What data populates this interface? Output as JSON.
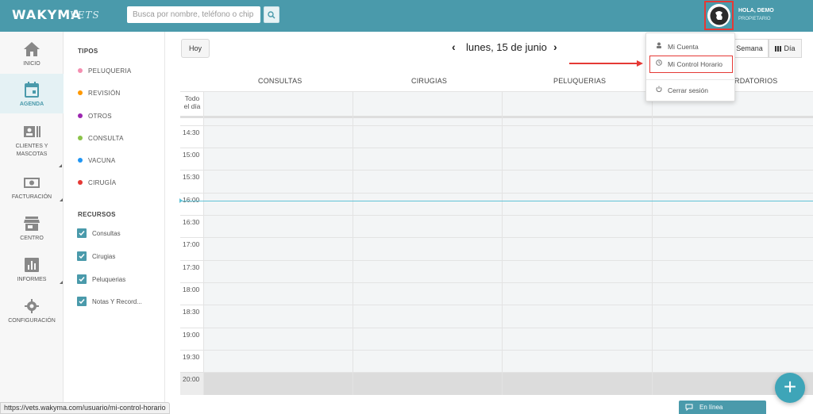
{
  "header": {
    "logo": "WAKYMA",
    "logo_sub": "VETS",
    "search_placeholder": "Busca por nombre, teléfono o chip",
    "greeting": "HOLA, DEMO",
    "role": "PROPIETARIO",
    "brand_color": "#4a9aab"
  },
  "nav": {
    "items": [
      {
        "label": "INICIO",
        "icon": "home-icon"
      },
      {
        "label": "AGENDA",
        "icon": "calendar-icon",
        "active": true
      },
      {
        "label": "CLIENTES Y",
        "label2": "MASCOTAS",
        "icon": "contacts-icon"
      },
      {
        "label": "FACTURACIÓN",
        "icon": "money-icon"
      },
      {
        "label": "CENTRO",
        "icon": "store-icon"
      },
      {
        "label": "INFORMES",
        "icon": "chart-icon"
      },
      {
        "label": "CONFIGURACIÓN",
        "icon": "gear-icon"
      }
    ]
  },
  "filters": {
    "types_title": "TIPOS",
    "types": [
      {
        "label": "PELUQUERIA",
        "color": "#f48fb1"
      },
      {
        "label": "REVISIÓN",
        "color": "#ff9800"
      },
      {
        "label": "OTROS",
        "color": "#9c27b0"
      },
      {
        "label": "CONSULTA",
        "color": "#8bc34a"
      },
      {
        "label": "VACUNA",
        "color": "#2196f3"
      },
      {
        "label": "CIRUGÍA",
        "color": "#e53935"
      }
    ],
    "resources_title": "RECURSOS",
    "resources": [
      {
        "label": "Consultas",
        "checked": true
      },
      {
        "label": "Cirugias",
        "checked": true
      },
      {
        "label": "Peluquerias",
        "checked": true
      },
      {
        "label": "Notas Y Record...",
        "checked": true
      }
    ]
  },
  "calendar": {
    "today_label": "Hoy",
    "date": "lunes, 15 de junio",
    "prev": "‹",
    "next": "›",
    "view_week": "Semana",
    "view_day": "Día",
    "columns": [
      "CONSULTAS",
      "CIRUGIAS",
      "PELUQUERIAS",
      "RDATORIOS"
    ],
    "all_day_line1": "Todo",
    "all_day_line2": "el día",
    "times": [
      "14:30",
      "15:00",
      "15:30",
      "16:00",
      "16:30",
      "17:00",
      "17:30",
      "18:00",
      "18:30",
      "19:00",
      "19:30",
      "20:00"
    ]
  },
  "dropdown": {
    "items": [
      {
        "label": "Mi Cuenta",
        "icon": "user-icon"
      },
      {
        "label": "Mi Control Horario",
        "icon": "clock-icon"
      },
      {
        "label": "Cerrar sesión",
        "icon": "power-icon"
      }
    ]
  },
  "status_url": "https://vets.wakyma.com/usuario/mi-control-horario",
  "chat_label": "En línea",
  "fab_label": "+"
}
